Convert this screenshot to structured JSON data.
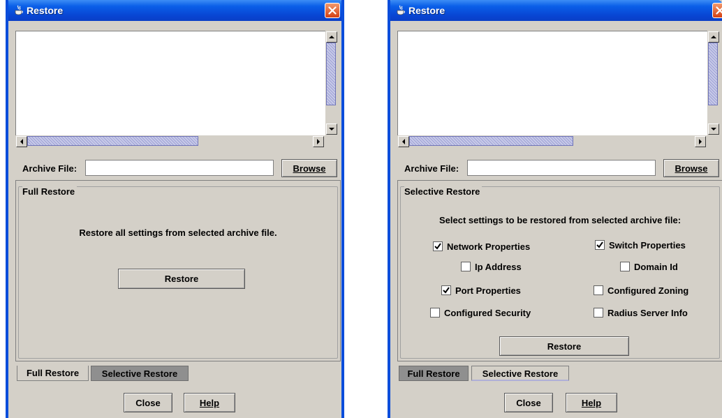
{
  "windows": [
    {
      "title": "Restore",
      "archive_label": "Archive File:",
      "archive_value": "",
      "browse_label": "Browse",
      "active_tab": "full",
      "panel": {
        "group_label": "Full Restore",
        "message": "Restore all settings from selected archive file.",
        "restore_label": "Restore"
      },
      "tabs": [
        "Full Restore",
        "Selective Restore"
      ],
      "close_label": "Close",
      "help_label": "Help"
    },
    {
      "title": "Restore",
      "archive_label": "Archive File:",
      "archive_value": "",
      "browse_label": "Browse",
      "active_tab": "selective",
      "panel": {
        "group_label": "Selective Restore",
        "message": "Select settings to be restored from selected archive file:",
        "restore_label": "Restore",
        "options": [
          {
            "label": "Network Properties",
            "checked": true
          },
          {
            "label": "Switch Properties",
            "checked": true
          },
          {
            "label": "Ip Address",
            "checked": false
          },
          {
            "label": "Domain Id",
            "checked": false
          },
          {
            "label": "Port Properties",
            "checked": true
          },
          {
            "label": "Configured Zoning",
            "checked": false
          },
          {
            "label": "Configured Security",
            "checked": false
          },
          {
            "label": "Radius Server Info",
            "checked": false
          }
        ]
      },
      "tabs": [
        "Full Restore",
        "Selective Restore"
      ],
      "close_label": "Close",
      "help_label": "Help"
    }
  ],
  "colors": {
    "titlebar": "#0a5fe8",
    "window_face": "#d4d0c8",
    "inactive_tab": "#8f8f8f",
    "close_button": "#d54012"
  },
  "icons": [
    "java-cup-icon",
    "close-x-icon",
    "arrow-up-icon",
    "arrow-down-icon",
    "arrow-left-icon",
    "arrow-right-icon",
    "checkmark-icon"
  ]
}
